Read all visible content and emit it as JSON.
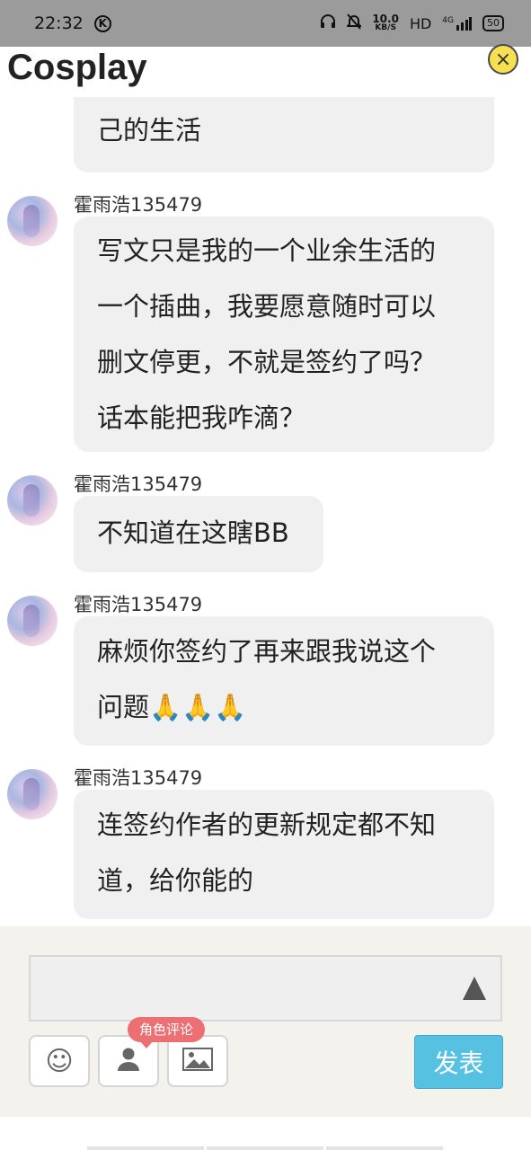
{
  "status_bar": {
    "time": "22:32",
    "k_icon": "K",
    "net_speed_value": "10.0",
    "net_speed_unit": "KB/S",
    "hd_label": "HD",
    "network_label": "4G",
    "battery": "50"
  },
  "header": {
    "title": "Cosplay",
    "close_icon": "×"
  },
  "messages": [
    {
      "sender": "",
      "text": "己的生活"
    },
    {
      "sender": "霍雨浩135479",
      "text": "写文只是我的一个业余生活的\n一个插曲，我要愿意随时可以\n删文停更，不就是签约了吗？\n话本能把我咋滴？"
    },
    {
      "sender": "霍雨浩135479",
      "text": "不知道在这瞎BB"
    },
    {
      "sender": "霍雨浩135479",
      "text": "麻烦你签约了再来跟我说这个\n问题🙏🙏🙏"
    },
    {
      "sender": "霍雨浩135479",
      "text": "连签约作者的更新规定都不知\n道，给你能的"
    }
  ],
  "composer": {
    "input_value": "",
    "emoji_icon": "☺",
    "role_badge": "角色评论",
    "post_button": "发表"
  }
}
